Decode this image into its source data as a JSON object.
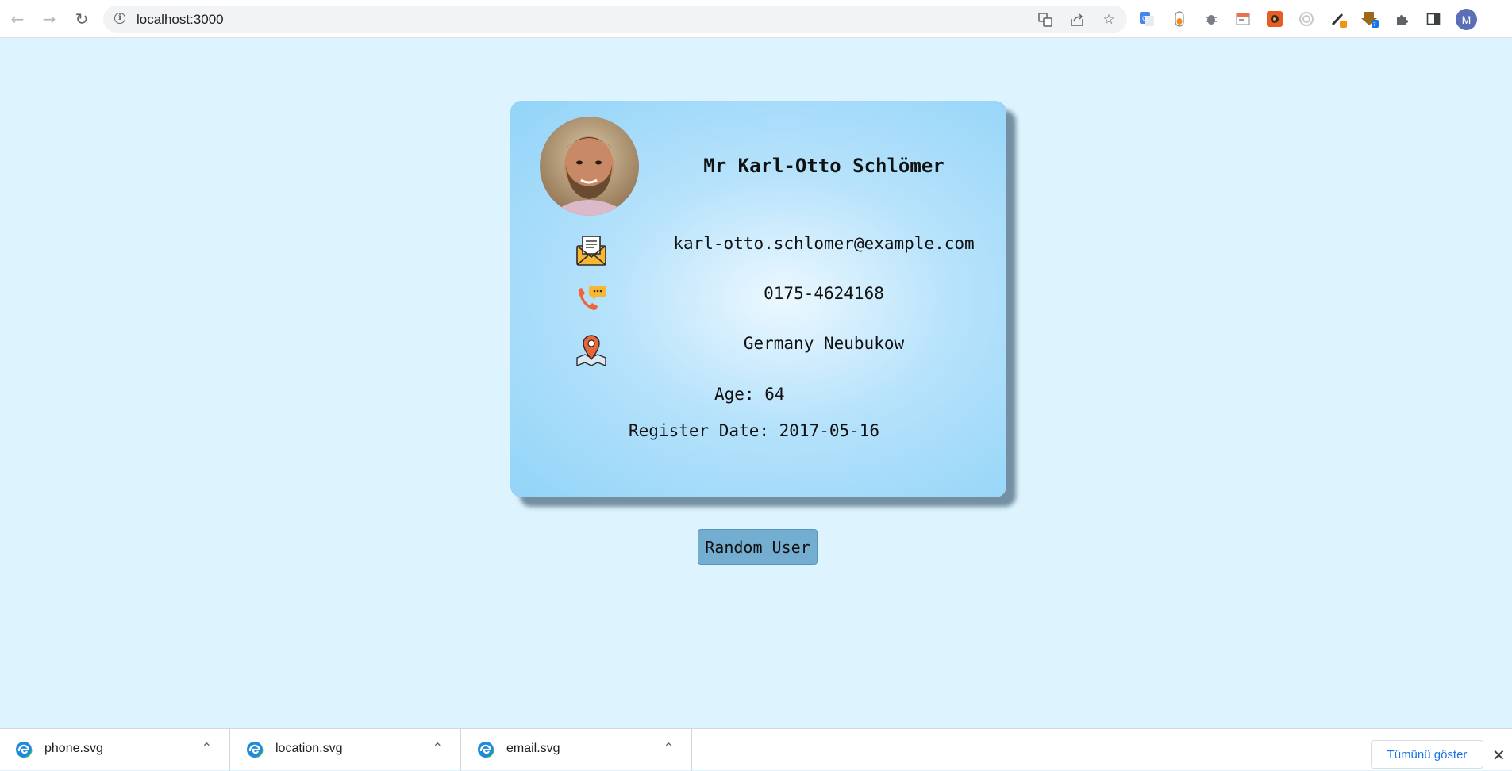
{
  "browser": {
    "url": "localhost:3000",
    "profile_initial": "M"
  },
  "user": {
    "name": "Mr Karl-Otto Schlömer",
    "email": "karl-otto.schlomer@example.com",
    "phone": "0175-4624168",
    "location": "Germany Neubukow",
    "age_label": "Age: 64",
    "register_label": "Register Date: 2017-05-16"
  },
  "actions": {
    "random_user_label": "Random User"
  },
  "downloads": {
    "items": [
      {
        "name": "phone.svg"
      },
      {
        "name": "location.svg"
      },
      {
        "name": "email.svg"
      }
    ],
    "show_all_label": "Tümünü göster"
  },
  "colors": {
    "page_bg": "#ddf3fd",
    "card_edge": "#92d4f8",
    "button_bg": "#73add0"
  }
}
